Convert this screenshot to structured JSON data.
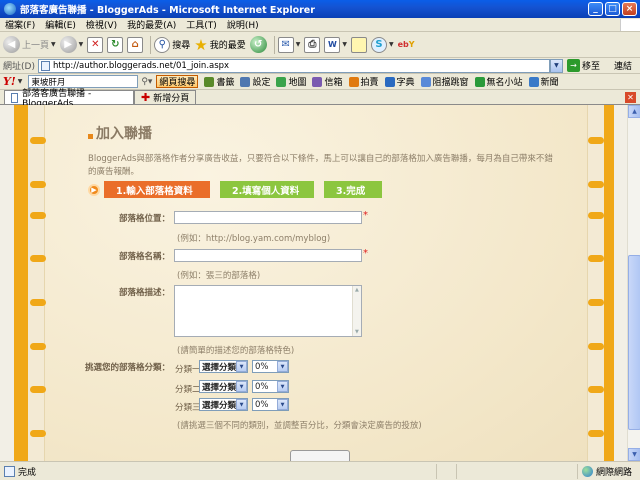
{
  "window": {
    "title": "部落客廣告聯播 - BloggerAds - Microsoft Internet Explorer"
  },
  "menu": [
    "檔案(F)",
    "編輯(E)",
    "檢視(V)",
    "我的最愛(A)",
    "工具(T)",
    "說明(H)"
  ],
  "toolbar": {
    "back": "上一頁",
    "search": "搜尋",
    "favorites": "我的最愛"
  },
  "address": {
    "label": "網址(D)",
    "url": "http://author.bloggerads.net/01_join.aspx",
    "go": "移至",
    "links": "連結"
  },
  "yahoo": {
    "search_value": "東坡肝月",
    "search_button": "網頁搜尋",
    "items": [
      "書籤",
      "設定",
      "地圖",
      "信箱",
      "拍賣",
      "字典",
      "阻擋跳窗",
      "無名小站",
      "新聞"
    ]
  },
  "tabs": {
    "active": "部落客廣告聯播 - BloggerAds",
    "new": "新增分頁"
  },
  "page": {
    "section_title": "加入聯播",
    "intro": "BloggerAds與部落格作者分享廣告收益，只要符合以下條件，馬上可以讓自己的部落格加入廣告聯播，每月為自己帶來不錯的廣告報酬。",
    "steps": [
      "1.輸入部落格資料",
      "2.填寫個人資料",
      "3.完成"
    ],
    "fields": {
      "blog_url_label": "部落格位置：",
      "blog_url_hint": "(例如：http://blog.yam.com/myblog)",
      "blog_name_label": "部落格名稱：",
      "blog_name_hint": "(例如：張三的部落格)",
      "blog_desc_label": "部落格描述：",
      "blog_desc_hint": "(請簡單的描述您的部落格特色)",
      "category_label": "挑選您的部落格分類：",
      "category_hint": "(請挑選三個不同的類別，並調整百分比，分類會決定廣告的投放)"
    },
    "categories": [
      {
        "label": "分類一",
        "select": "選擇分類",
        "percent": "0%"
      },
      {
        "label": "分類二",
        "select": "選擇分類",
        "percent": "0%"
      },
      {
        "label": "分類三",
        "select": "選擇分類",
        "percent": "0%"
      }
    ],
    "required_mark": "*"
  },
  "status": {
    "text": "完成",
    "zone": "網際網路"
  }
}
